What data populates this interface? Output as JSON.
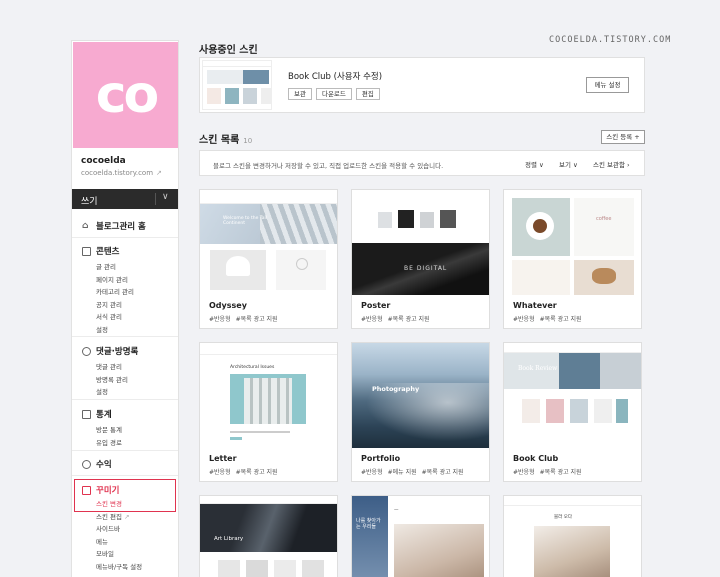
{
  "watermark": "COCOELDA.TISTORY.COM",
  "blog": {
    "logo_text": "co",
    "name": "cocoelda",
    "url": "cocoelda.tistory.com"
  },
  "sidebar": {
    "write_label": "쓰기",
    "home_label": "블로그관리 홈",
    "groups": [
      {
        "title": "콘텐츠",
        "items": [
          "글 관리",
          "페이지 관리",
          "카테고리 관리",
          "공지 관리",
          "서식 관리",
          "설정"
        ]
      },
      {
        "title": "댓글·방명록",
        "items": [
          "댓글 관리",
          "방명록 관리",
          "설정"
        ]
      },
      {
        "title": "통계",
        "items": [
          "방문 통계",
          "유입 경로"
        ]
      },
      {
        "title": "수익",
        "items": []
      },
      {
        "title": "꾸미기",
        "items": [
          "스킨 변경",
          "스킨 편집",
          "사이드바",
          "메뉴",
          "모바일",
          "메뉴바/구독 설정"
        ]
      }
    ]
  },
  "current_skin": {
    "section_title": "사용중인 스킨",
    "name": "Book Club (사용자 수정)",
    "buttons": [
      "보관",
      "다운로드",
      "편집"
    ],
    "menu_button": "메뉴 설정"
  },
  "skin_list": {
    "section_title": "스킨 목록",
    "count": "10",
    "register_button": "스킨 등록 +",
    "info": "블로그 스킨을 변경하거나 저장할 수 있고, 직접 업로드한 스킨을 적용할 수 있습니다.",
    "controls": [
      "정렬 ∨",
      "보기 ∨",
      "스킨 보관함 ›"
    ]
  },
  "cards": [
    {
      "name": "Odyssey",
      "tags": [
        "#반응형",
        "#목록 광고 지원"
      ],
      "caption": "Welcome to the Tall Continent"
    },
    {
      "name": "Poster",
      "tags": [
        "#반응형",
        "#목록 광고 지원"
      ],
      "caption": "BE DIGITAL"
    },
    {
      "name": "Whatever",
      "tags": [
        "#반응형",
        "#목록 광고 지원"
      ],
      "caption": "coffee"
    },
    {
      "name": "Letter",
      "tags": [
        "#반응형",
        "#목록 광고 지원"
      ],
      "caption": "Architectural Issues"
    },
    {
      "name": "Portfolio",
      "tags": [
        "#반응형",
        "#메뉴 지원",
        "#목록 광고 지원"
      ],
      "caption": "Photography"
    },
    {
      "name": "Book Club",
      "tags": [
        "#반응형",
        "#목록 광고 지원"
      ],
      "caption": "Book Review"
    },
    {
      "name": "",
      "tags": [],
      "caption": "Art Library"
    },
    {
      "name": "",
      "tags": [],
      "caption": "나를 찾아가는 우리들"
    },
    {
      "name": "",
      "tags": [],
      "caption": "블라 오다"
    }
  ]
}
